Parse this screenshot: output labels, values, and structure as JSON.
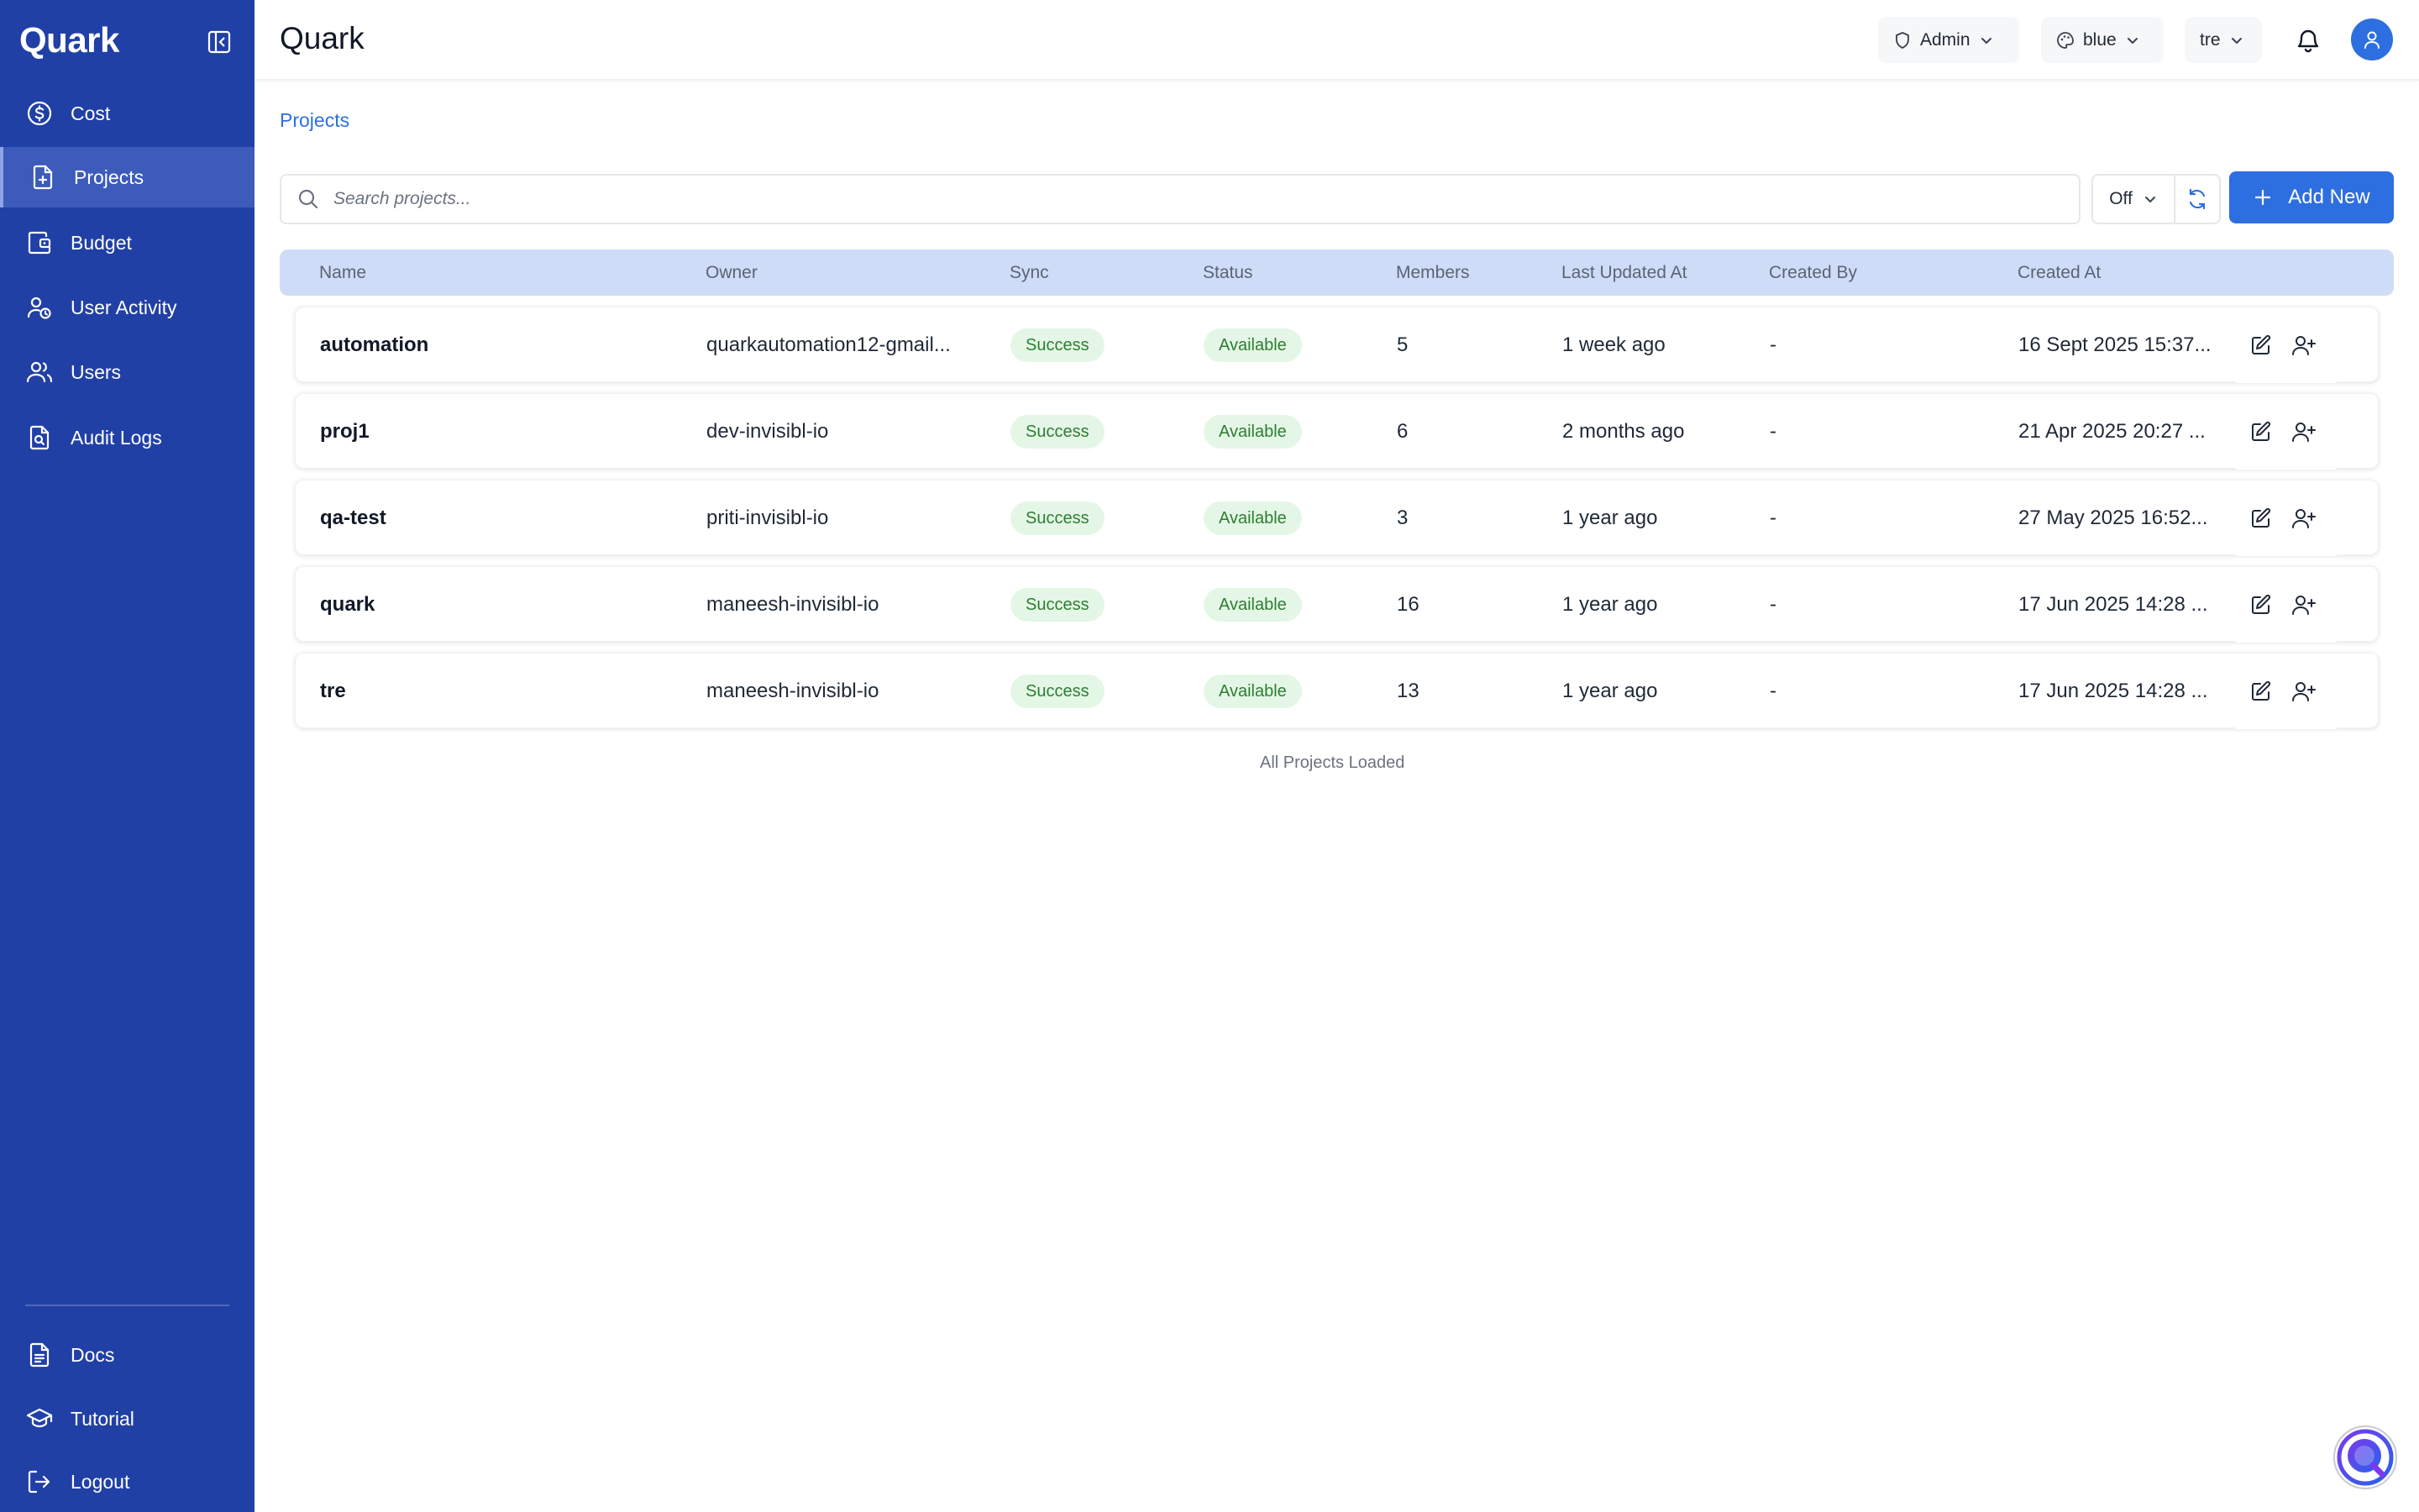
{
  "app": {
    "brand": "Quark",
    "page_title": "Quark"
  },
  "sidebar": {
    "items": [
      {
        "label": "Cost",
        "icon": "dollar-circle-icon"
      },
      {
        "label": "Projects",
        "icon": "file-plus-icon",
        "active": true
      },
      {
        "label": "Budget",
        "icon": "wallet-icon"
      },
      {
        "label": "User Activity",
        "icon": "user-activity-icon"
      },
      {
        "label": "Users",
        "icon": "users-icon"
      },
      {
        "label": "Audit Logs",
        "icon": "file-search-icon"
      }
    ],
    "bottom_items": [
      {
        "label": "Docs",
        "icon": "document-icon"
      },
      {
        "label": "Tutorial",
        "icon": "graduation-cap-icon"
      },
      {
        "label": "Logout",
        "icon": "logout-icon"
      }
    ]
  },
  "header": {
    "role": "Admin",
    "theme": "blue",
    "workspace": "tre"
  },
  "breadcrumb": "Projects",
  "toolbar": {
    "search_placeholder": "Search projects...",
    "toggle_value": "Off",
    "add_label": "Add New"
  },
  "table": {
    "columns": [
      "Name",
      "Owner",
      "Sync",
      "Status",
      "Members",
      "Last Updated At",
      "Created By",
      "Created At"
    ],
    "rows": [
      {
        "name": "automation",
        "owner": "quarkautomation12-gmail...",
        "sync": "Success",
        "status": "Available",
        "members": "5",
        "updated": "1 week ago",
        "created_by": "-",
        "created_at": "16 Sept 2025 15:37..."
      },
      {
        "name": "proj1",
        "owner": "dev-invisibl-io",
        "sync": "Success",
        "status": "Available",
        "members": "6",
        "updated": "2 months ago",
        "created_by": "-",
        "created_at": "21 Apr 2025 20:27 ..."
      },
      {
        "name": "qa-test",
        "owner": "priti-invisibl-io",
        "sync": "Success",
        "status": "Available",
        "members": "3",
        "updated": "1 year ago",
        "created_by": "-",
        "created_at": "27 May 2025 16:52..."
      },
      {
        "name": "quark",
        "owner": "maneesh-invisibl-io",
        "sync": "Success",
        "status": "Available",
        "members": "16",
        "updated": "1 year ago",
        "created_by": "-",
        "created_at": "17 Jun 2025 14:28 ..."
      },
      {
        "name": "tre",
        "owner": "maneesh-invisibl-io",
        "sync": "Success",
        "status": "Available",
        "members": "13",
        "updated": "1 year ago",
        "created_by": "-",
        "created_at": "17 Jun 2025 14:28 ..."
      }
    ],
    "footer": "All Projects Loaded"
  },
  "colors": {
    "sidebar": "#2140a6",
    "accent": "#2d6fe0",
    "success_bg": "#e4f7e6",
    "success_text": "#2e7d32"
  }
}
